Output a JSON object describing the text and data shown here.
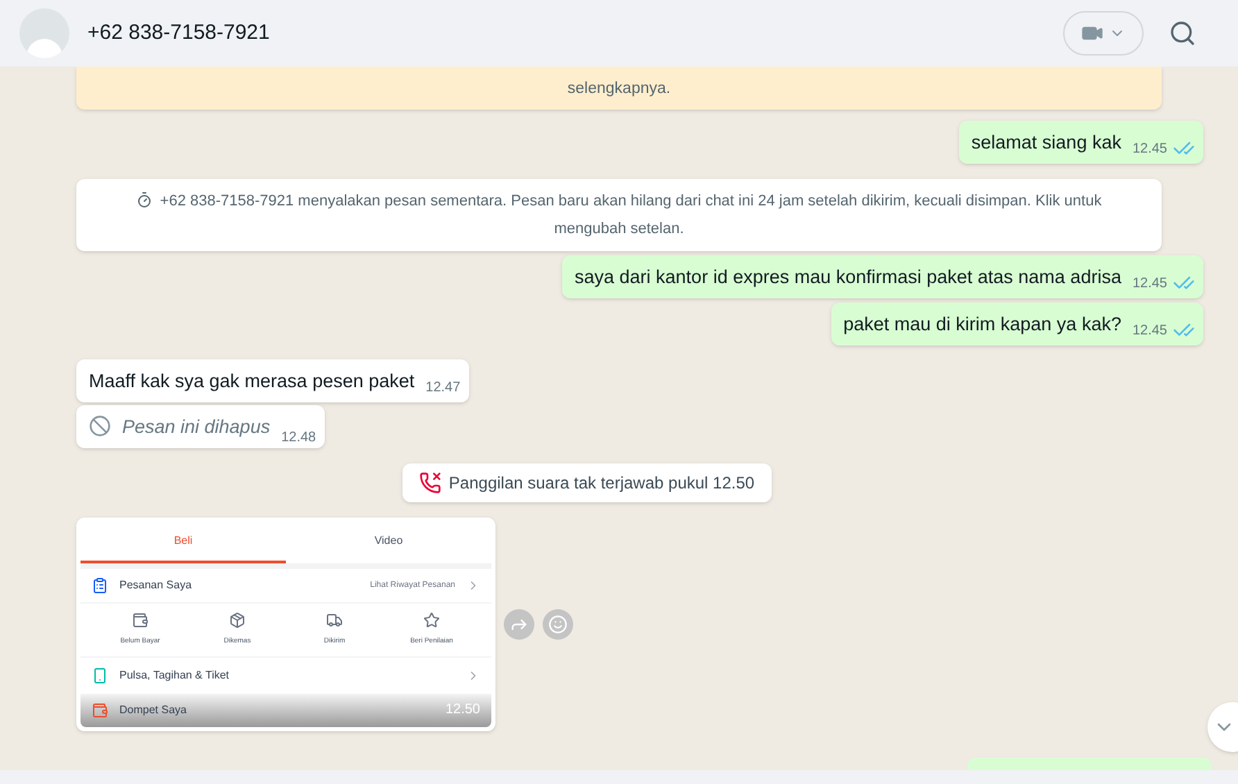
{
  "header": {
    "title": "+62 838-7158-7921"
  },
  "banner": {
    "text": "selengkapnya."
  },
  "messages": [
    {
      "kind": "out",
      "text": "selamat siang kak",
      "time": "12.45",
      "read": true
    },
    {
      "kind": "system",
      "text": "+62 838-7158-7921 menyalakan pesan sementara. Pesan baru akan hilang dari chat ini 24 jam setelah dikirim, kecuali disimpan. Klik untuk mengubah setelan."
    },
    {
      "kind": "out",
      "text": "saya dari kantor id expres mau konfirmasi paket atas nama adrisa",
      "time": "12.45",
      "read": true
    },
    {
      "kind": "out",
      "text": "paket mau di kirim kapan ya kak?",
      "time": "12.45",
      "read": true
    },
    {
      "kind": "in",
      "text": "Maaff kak sya gak merasa pesen paket",
      "time": "12.47"
    },
    {
      "kind": "deleted",
      "text": "Pesan ini dihapus",
      "time": "12.48"
    },
    {
      "kind": "call",
      "text": "Panggilan suara tak terjawab pukul 12.50"
    },
    {
      "kind": "image",
      "time": "12.50",
      "shot": {
        "tabs": [
          {
            "label": "Beli",
            "selected": true
          },
          {
            "label": "Video",
            "selected": false
          }
        ],
        "order_title": "Pesanan Saya",
        "order_link": "Lihat Riwayat Pesanan",
        "statuses": [
          "Belum Bayar",
          "Dikemas",
          "Dikirim",
          "Beri Penilaian"
        ],
        "bills": "Pulsa, Tagihan & Tiket",
        "wallet": "Dompet Saya"
      }
    }
  ]
}
